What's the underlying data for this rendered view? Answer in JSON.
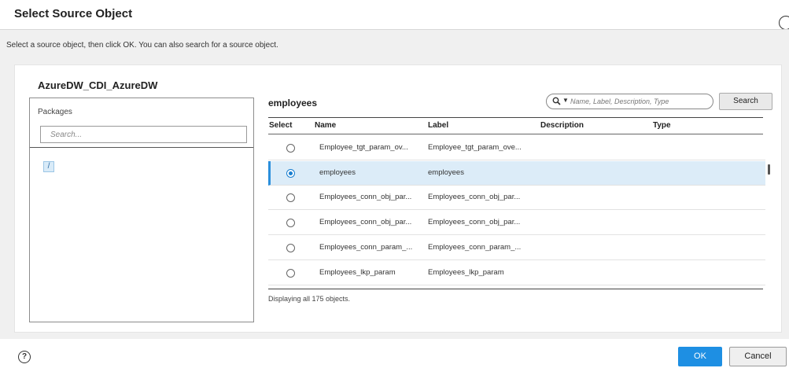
{
  "dialog": {
    "title": "Select Source Object",
    "instructions": "Select a source object, then click OK. You can also search for a source object."
  },
  "connection": {
    "name": "AzureDW_CDI_AzureDW"
  },
  "packages": {
    "label": "Packages",
    "search_placeholder": "Search...",
    "root_folder": "/"
  },
  "objects": {
    "title": "employees",
    "search_placeholder": "Name, Label, Description, Type",
    "search_button": "Search",
    "columns": [
      "Select",
      "Name",
      "Label",
      "Description",
      "Type"
    ],
    "rows": [
      {
        "name": "Employee_tgt_param_ov...",
        "label": "Employee_tgt_param_ove...",
        "description": "",
        "type": "",
        "selected": false
      },
      {
        "name": "employees",
        "label": "employees",
        "description": "",
        "type": "",
        "selected": true
      },
      {
        "name": "Employees_conn_obj_par...",
        "label": "Employees_conn_obj_par...",
        "description": "",
        "type": "",
        "selected": false
      },
      {
        "name": "Employees_conn_obj_par...",
        "label": "Employees_conn_obj_par...",
        "description": "",
        "type": "",
        "selected": false
      },
      {
        "name": "Employees_conn_param_...",
        "label": "Employees_conn_param_...",
        "description": "",
        "type": "",
        "selected": false
      },
      {
        "name": "Employees_lkp_param",
        "label": "Employees_lkp_param",
        "description": "",
        "type": "",
        "selected": false
      }
    ],
    "footer": "Displaying all 175 objects."
  },
  "buttons": {
    "ok": "OK",
    "cancel": "Cancel",
    "help": "?"
  },
  "colors": {
    "accent": "#1e8fe3",
    "selected_row": "#dcecf8"
  }
}
